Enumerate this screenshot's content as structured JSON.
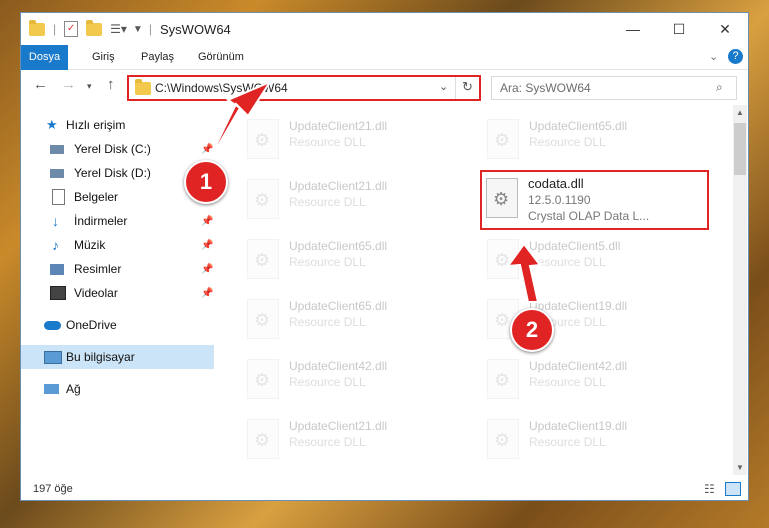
{
  "window": {
    "title": "SysWOW64"
  },
  "window_controls": {
    "minimize": "—",
    "maximize": "☐",
    "close": "✕"
  },
  "ribbon": {
    "tabs": [
      "Dosya",
      "Giriş",
      "Paylaş",
      "Görünüm"
    ]
  },
  "address": {
    "path": "C:\\Windows\\SysWOW64"
  },
  "search": {
    "placeholder": "Ara: SysWOW64"
  },
  "sidebar": {
    "items": [
      {
        "label": "Hızlı erişim",
        "icon": "star-icon"
      },
      {
        "label": "Yerel Disk (C:)",
        "icon": "drive-icon"
      },
      {
        "label": "Yerel Disk (D:)",
        "icon": "drive-icon"
      },
      {
        "label": "Belgeler",
        "icon": "document-icon"
      },
      {
        "label": "İndirmeler",
        "icon": "download-icon"
      },
      {
        "label": "Müzik",
        "icon": "music-icon"
      },
      {
        "label": "Resimler",
        "icon": "image-icon"
      },
      {
        "label": "Videolar",
        "icon": "video-icon"
      },
      {
        "label": "OneDrive",
        "icon": "cloud-icon"
      },
      {
        "label": "Bu bilgisayar",
        "icon": "computer-icon"
      },
      {
        "label": "Ağ",
        "icon": "network-icon"
      }
    ]
  },
  "files": [
    {
      "name": "UpdateClient21.dll",
      "type": "Resource DLL"
    },
    {
      "name": "UpdateClient65.dll",
      "type": "Resource DLL"
    },
    {
      "name": "UpdateClient21.dll",
      "type": "Resource DLL"
    },
    {
      "name": "codata.dll",
      "version": "12.5.0.1190",
      "desc": "Crystal OLAP Data L..."
    },
    {
      "name": "UpdateClient65.dll",
      "type": "Resource DLL"
    },
    {
      "name": "UpdateClient5.dll",
      "type": "Resource DLL"
    },
    {
      "name": "UpdateClient65.dll",
      "type": "Resource DLL"
    },
    {
      "name": "UpdateClient19.dll",
      "type": "Resource DLL"
    },
    {
      "name": "UpdateClient42.dll",
      "type": "Resource DLL"
    },
    {
      "name": "UpdateClient42.dll",
      "type": "Resource DLL"
    },
    {
      "name": "UpdateClient21.dll",
      "type": "Resource DLL"
    },
    {
      "name": "UpdateClient19.dll",
      "type": "Resource DLL"
    }
  ],
  "status": {
    "count": "197 öğe"
  },
  "callouts": [
    "1",
    "2"
  ],
  "colors": {
    "accent": "#1979ca",
    "highlight": "#e02424",
    "selection": "#cce4f7"
  }
}
